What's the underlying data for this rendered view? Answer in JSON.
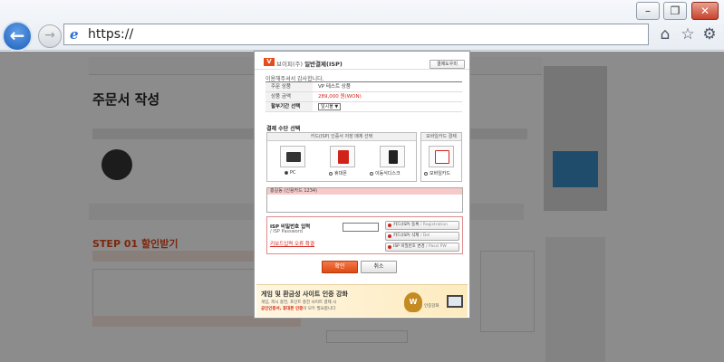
{
  "browser": {
    "address": "https://",
    "win_minimize": "–",
    "win_restore": "❐",
    "win_close": "✕"
  },
  "background_page": {
    "title": "주문서 작성",
    "step": "STEP 01 할인받기"
  },
  "dialog": {
    "logo_letter": "V",
    "title_prefix": "브이피(주)",
    "title": "일반결제(ISP)",
    "guide_button": "결제도우미",
    "thanks": "이용해주셔서 감사합니다.",
    "info_rows": [
      {
        "label": "주문 상품",
        "value": "VP 테스트 상품"
      },
      {
        "label": "상품 금액",
        "value": "289,000 원(WON)"
      },
      {
        "label": "할부기간 선택",
        "value": "일시불"
      }
    ],
    "method_title": "결제 수단 선택",
    "card_box_caption": "카드(ISP) 인증서 저장 매체 선택",
    "devices": [
      {
        "label": "PC",
        "selected": true
      },
      {
        "label": "휴대폰",
        "selected": false
      },
      {
        "label": "이동식디스크",
        "selected": false
      }
    ],
    "mobile_caption": "모바일카드 결제",
    "mobile_label": "모바일카드",
    "card_item": "홍길동 (신용카드 1234)",
    "pw_title": "ISP 비밀번호 입력",
    "pw_sub": "/ ISP Password",
    "pw_link": "키보드입력 오류 확결",
    "actions": [
      {
        "ko": "카드(ISP) 등록",
        "en": "/ Registration"
      },
      {
        "ko": "카드(ISP) 삭제",
        "en": "/ Del"
      },
      {
        "ko": "ISP 비밀번호 변경",
        "en": "/ Passl PW"
      }
    ],
    "ok_button": "확인",
    "cancel_button": "취소",
    "banner": {
      "title": "게임 및 환금성 사이트 인증 강화",
      "line1": "게임, 피시 충전, 포인트 충전 사이트 결제 시",
      "line2_hl": "공인인증서, 휴대폰 인증",
      "line2_rest": "이 모두 필요합니다",
      "badge": "W",
      "tag": "인증강화"
    }
  }
}
